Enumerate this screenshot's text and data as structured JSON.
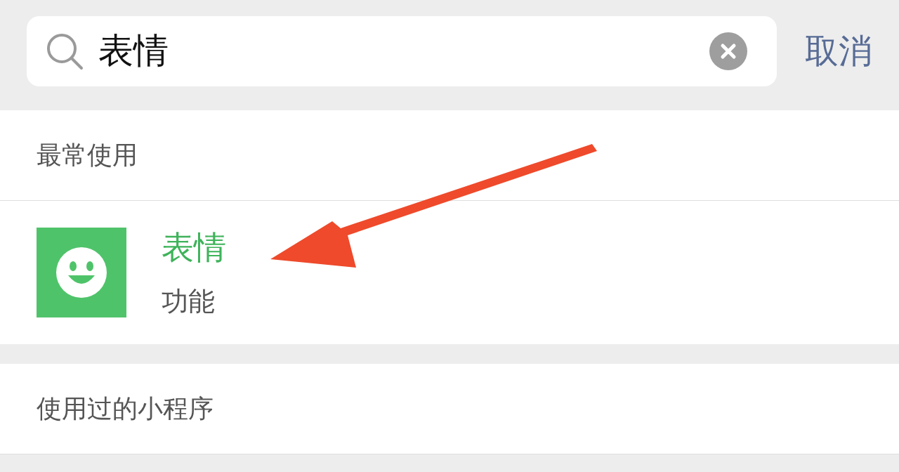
{
  "search": {
    "value": "表情",
    "cancel": "取消"
  },
  "sections": [
    {
      "header": "最常使用",
      "results": [
        {
          "title": "表情",
          "subtitle": "功能"
        }
      ]
    },
    {
      "header": "使用过的小程序"
    }
  ]
}
